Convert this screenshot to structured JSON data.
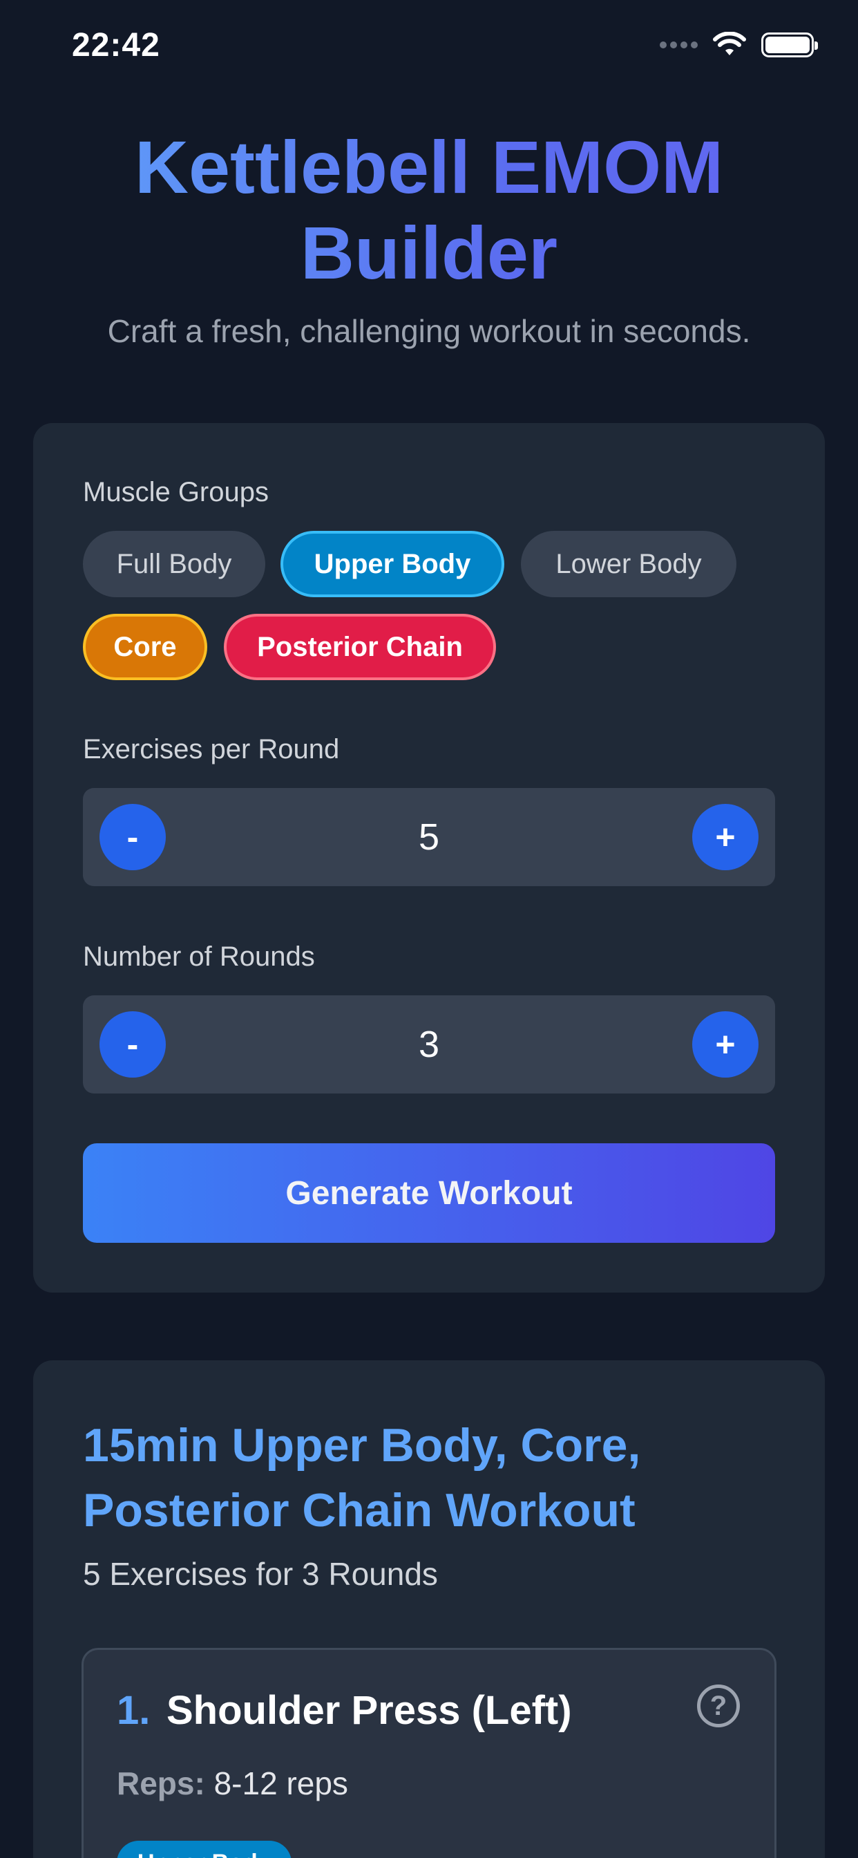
{
  "status_bar": {
    "time": "22:42",
    "icons": [
      "cellular-signal-icon",
      "wifi-icon",
      "battery-icon"
    ]
  },
  "header": {
    "title": "Kettlebell EMOM Builder",
    "subtitle": "Craft a fresh, challenging workout in seconds."
  },
  "config": {
    "muscle_groups_label": "Muscle Groups",
    "muscle_groups": [
      {
        "label": "Full Body",
        "selected": false
      },
      {
        "label": "Upper Body",
        "selected": true,
        "color": "#0284c7"
      },
      {
        "label": "Lower Body",
        "selected": false
      },
      {
        "label": "Core",
        "selected": true,
        "color": "#d97706"
      },
      {
        "label": "Posterior Chain",
        "selected": true,
        "color": "#e11d48"
      }
    ],
    "exercises_label": "Exercises per Round",
    "exercises_value": "5",
    "rounds_label": "Number of Rounds",
    "rounds_value": "3",
    "minus_label": "-",
    "plus_label": "+",
    "generate_label": "Generate Workout"
  },
  "workout": {
    "title": "15min Upper Body, Core, Posterior Chain Workout",
    "meta": "5 Exercises for 3 Rounds",
    "exercises": [
      {
        "number": "1.",
        "name": "Shoulder Press (Left)",
        "reps_label": "Reps:",
        "reps": "8-12 reps",
        "tag": "Upper Body",
        "help_symbol": "?"
      }
    ]
  },
  "colors": {
    "background": "#111827",
    "card": "#1f2937",
    "accent": "#2563eb",
    "title_gradient_start": "#60a5fa",
    "title_gradient_end": "#6366f1"
  }
}
